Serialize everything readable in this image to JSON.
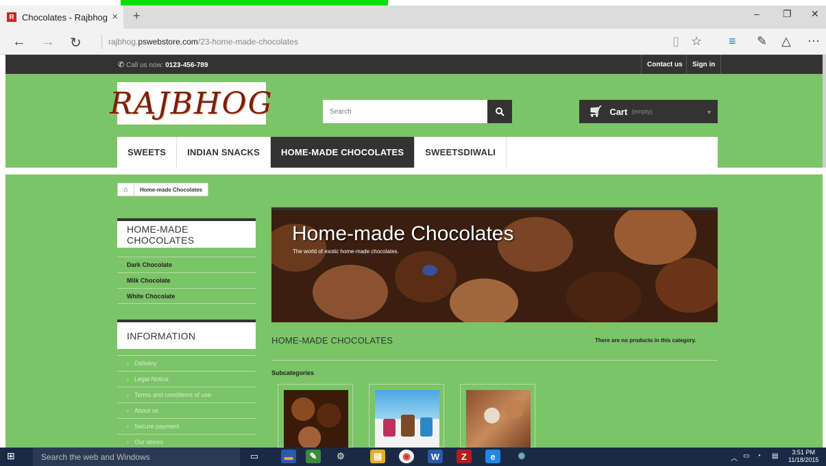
{
  "browser": {
    "tab_title": "Chocolates - Rajbhog",
    "tab_close": "×",
    "new_tab": "+",
    "favicon_letter": "R",
    "url_prefix": "rajbhog.",
    "url_domain": "pswebstore.com",
    "url_path": "/23-home-made-chocolates",
    "window_controls": [
      "–",
      "❐",
      "✕"
    ],
    "nav_buttons": [
      "←",
      "→",
      "↻"
    ],
    "toolbar_icons": [
      "reading-view-icon",
      "favorite-star-icon",
      "hub-icon",
      "web-note-icon",
      "share-icon",
      "more-icon"
    ]
  },
  "topbar": {
    "call_label": "Call us now:",
    "phone": "0123-456-789",
    "contact": "Contact us",
    "signin": "Sign in"
  },
  "header": {
    "logo_text": "RAJBHOG",
    "search_placeholder": "Search",
    "cart_label": "Cart",
    "cart_status": "(empty)"
  },
  "menu": {
    "items": [
      "SWEETS",
      "INDIAN SNACKS",
      "HOME-MADE CHOCOLATES",
      "SWEETSDIWALI"
    ],
    "active_index": 2
  },
  "breadcrumb": {
    "current": "Home-made Chocolates"
  },
  "sidebar": {
    "categories_title": "HOME-MADE CHOCOLATES",
    "categories": [
      "Dark Chocolate",
      "Milk Chocolate",
      "White Chocolate"
    ],
    "info_title": "INFORMATION",
    "info_links": [
      "Delivery",
      "Legal Notice",
      "Terms and conditions of use",
      "About us",
      "Secure payment",
      "Our stores"
    ]
  },
  "main": {
    "banner_title": "Home-made Chocolates",
    "banner_subtitle": "The world of exotic home-made chocolates.",
    "category_title": "HOME-MADE CHOCOLATES",
    "no_products": "There are no products in this category.",
    "subcategories_label": "Subcategories"
  },
  "taskbar": {
    "search_text": "Search the web and Windows",
    "time": "3:51 PM",
    "date": "11/18/2015"
  },
  "colors": {
    "site_green": "#7bc467",
    "dark": "#333333",
    "taskbar": "#1a2a45"
  }
}
